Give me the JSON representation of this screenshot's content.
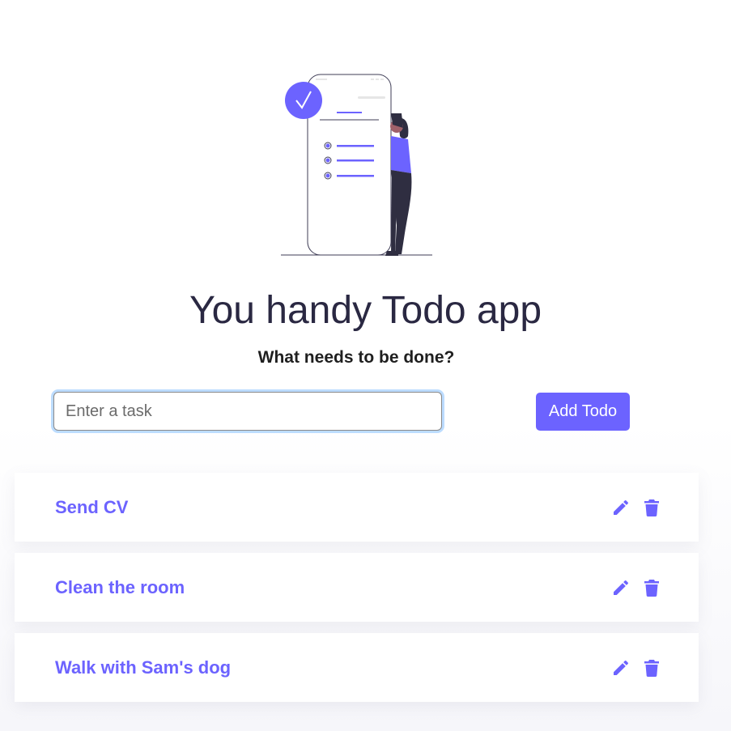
{
  "header": {
    "title": "You handy Todo app",
    "subtitle": "What needs to be done?"
  },
  "form": {
    "input_placeholder": "Enter a task",
    "input_value": "",
    "add_button_label": "Add Todo"
  },
  "todos": [
    {
      "text": "Send CV",
      "edit_icon": "pencil-icon",
      "delete_icon": "trash-icon"
    },
    {
      "text": "Clean the room",
      "edit_icon": "pencil-icon",
      "delete_icon": "trash-icon"
    },
    {
      "text": "Walk with Sam's dog",
      "edit_icon": "pencil-icon",
      "delete_icon": "trash-icon"
    }
  ],
  "colors": {
    "accent": "#6c63ff",
    "title_text": "#2a2842",
    "focus_ring": "#bcdcff"
  }
}
